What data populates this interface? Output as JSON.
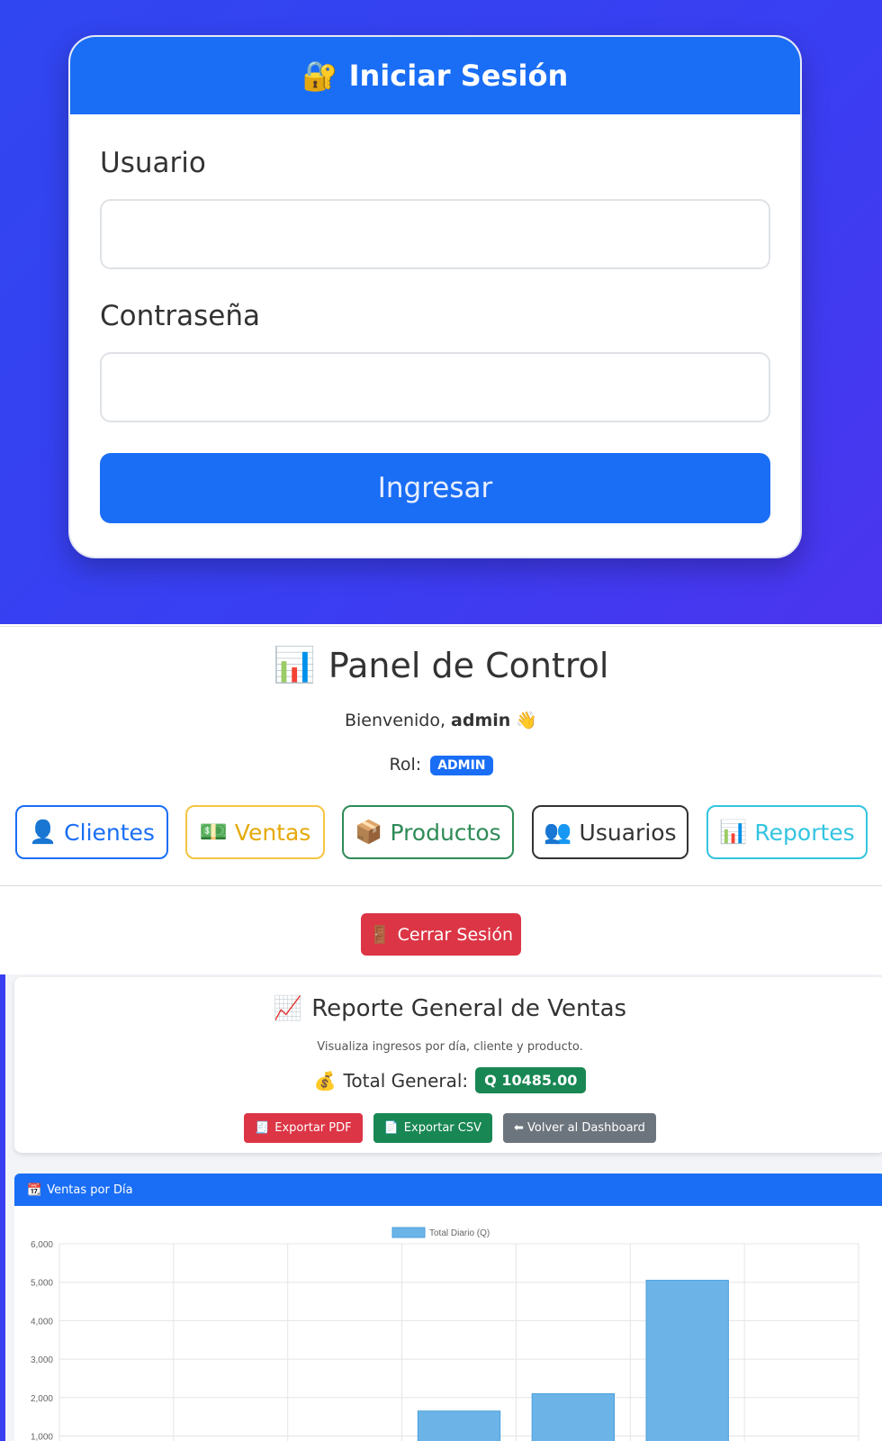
{
  "login": {
    "title": "Iniciar Sesión",
    "title_icon": "lock-key-icon",
    "username_label": "Usuario",
    "username_value": "",
    "password_label": "Contraseña",
    "password_value": "",
    "submit_label": "Ingresar"
  },
  "panel": {
    "title": "Panel de Control",
    "title_icon": "bar-chart-icon",
    "welcome_prefix": "Bienvenido,",
    "username": "admin",
    "welcome_icon": "waving-hand-icon",
    "role_label": "Rol:",
    "role": "ADMIN",
    "nav": [
      {
        "label": "Clientes",
        "icon": "person-icon",
        "emoji": "👤"
      },
      {
        "label": "Ventas",
        "icon": "money-icon",
        "emoji": "💵"
      },
      {
        "label": "Productos",
        "icon": "package-icon",
        "emoji": "📦"
      },
      {
        "label": "Usuarios",
        "icon": "people-icon",
        "emoji": "👥"
      },
      {
        "label": "Reportes",
        "icon": "bar-chart-icon",
        "emoji": "📊"
      }
    ],
    "logout_label": "Cerrar Sesión",
    "logout_icon": "door-icon"
  },
  "report": {
    "title": "Reporte General de Ventas",
    "title_icon": "chart-increasing-icon",
    "subtitle": "Visualiza ingresos por día, cliente y producto.",
    "total_label": "Total General:",
    "total_icon": "money-bag-icon",
    "total_value": "Q 10485.00",
    "actions": {
      "pdf": "Exportar PDF",
      "csv": "Exportar CSV",
      "back": "⬅ Volver al Dashboard"
    },
    "colors": {
      "pdf": "#dc3545",
      "csv": "#198754",
      "back": "#6c757d",
      "primary": "#1a6ef5"
    }
  },
  "chart_card": {
    "header": "Ventas por Día",
    "header_icon": "calendar-icon"
  },
  "chart_data": {
    "type": "bar",
    "legend": [
      "Total Diario (Q)"
    ],
    "series": [
      {
        "name": "Total Diario (Q)",
        "values": [
          null,
          null,
          null,
          1650,
          2100,
          5050,
          null
        ],
        "color": "#6cb4e8"
      }
    ],
    "category_count": 7,
    "y_ticks": [
      "1,000",
      "2,000",
      "3,000",
      "4,000",
      "5,000",
      "6,000"
    ],
    "ylim": [
      0,
      6000
    ],
    "grid": true,
    "legend_position": "top"
  }
}
